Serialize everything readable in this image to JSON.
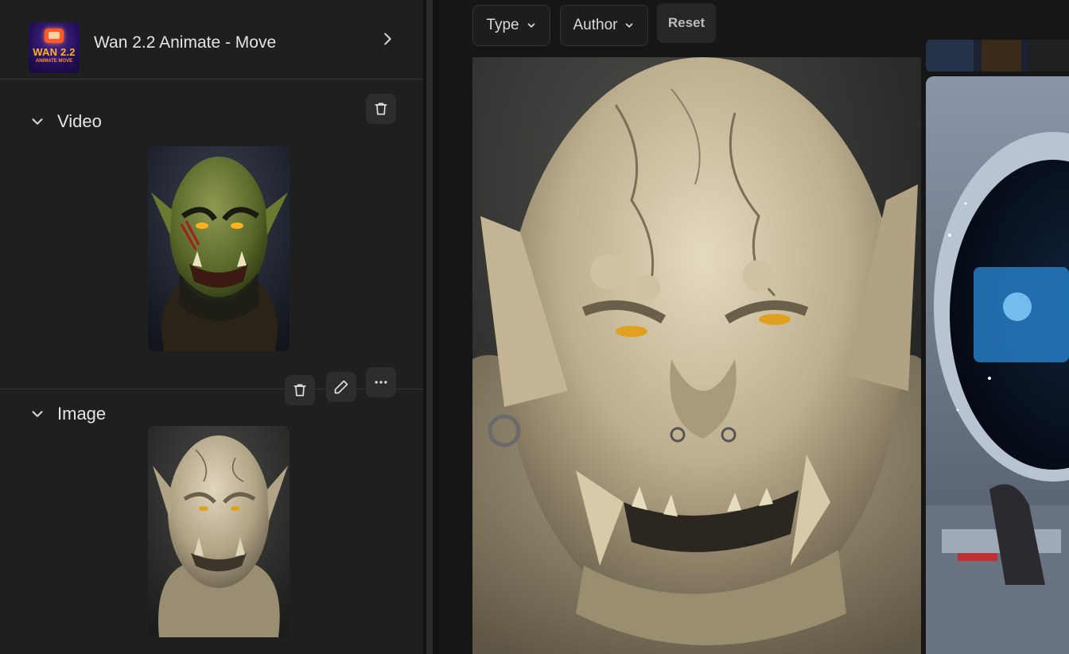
{
  "model": {
    "title": "Wan 2.2 Animate - Move",
    "thumb_line1": "WAN 2.2",
    "thumb_line2": "ANIMATE MOVE"
  },
  "sections": {
    "video": {
      "label": "Video"
    },
    "image": {
      "label": "Image"
    }
  },
  "filters": {
    "type_label": "Type",
    "author_label": "Author",
    "reset_label": "Reset"
  },
  "colors": {
    "panel_bg": "#1f1f1f",
    "page_bg": "#161616",
    "button_bg": "#2d2d2d",
    "text": "#e4e4e4"
  },
  "icons": {
    "header_chevron": "chevron-right-icon",
    "section_chevron": "chevron-down-icon",
    "delete": "trash-icon",
    "edit": "pencil-icon",
    "more": "more-dots-icon",
    "dropdown": "chevron-down-icon"
  }
}
